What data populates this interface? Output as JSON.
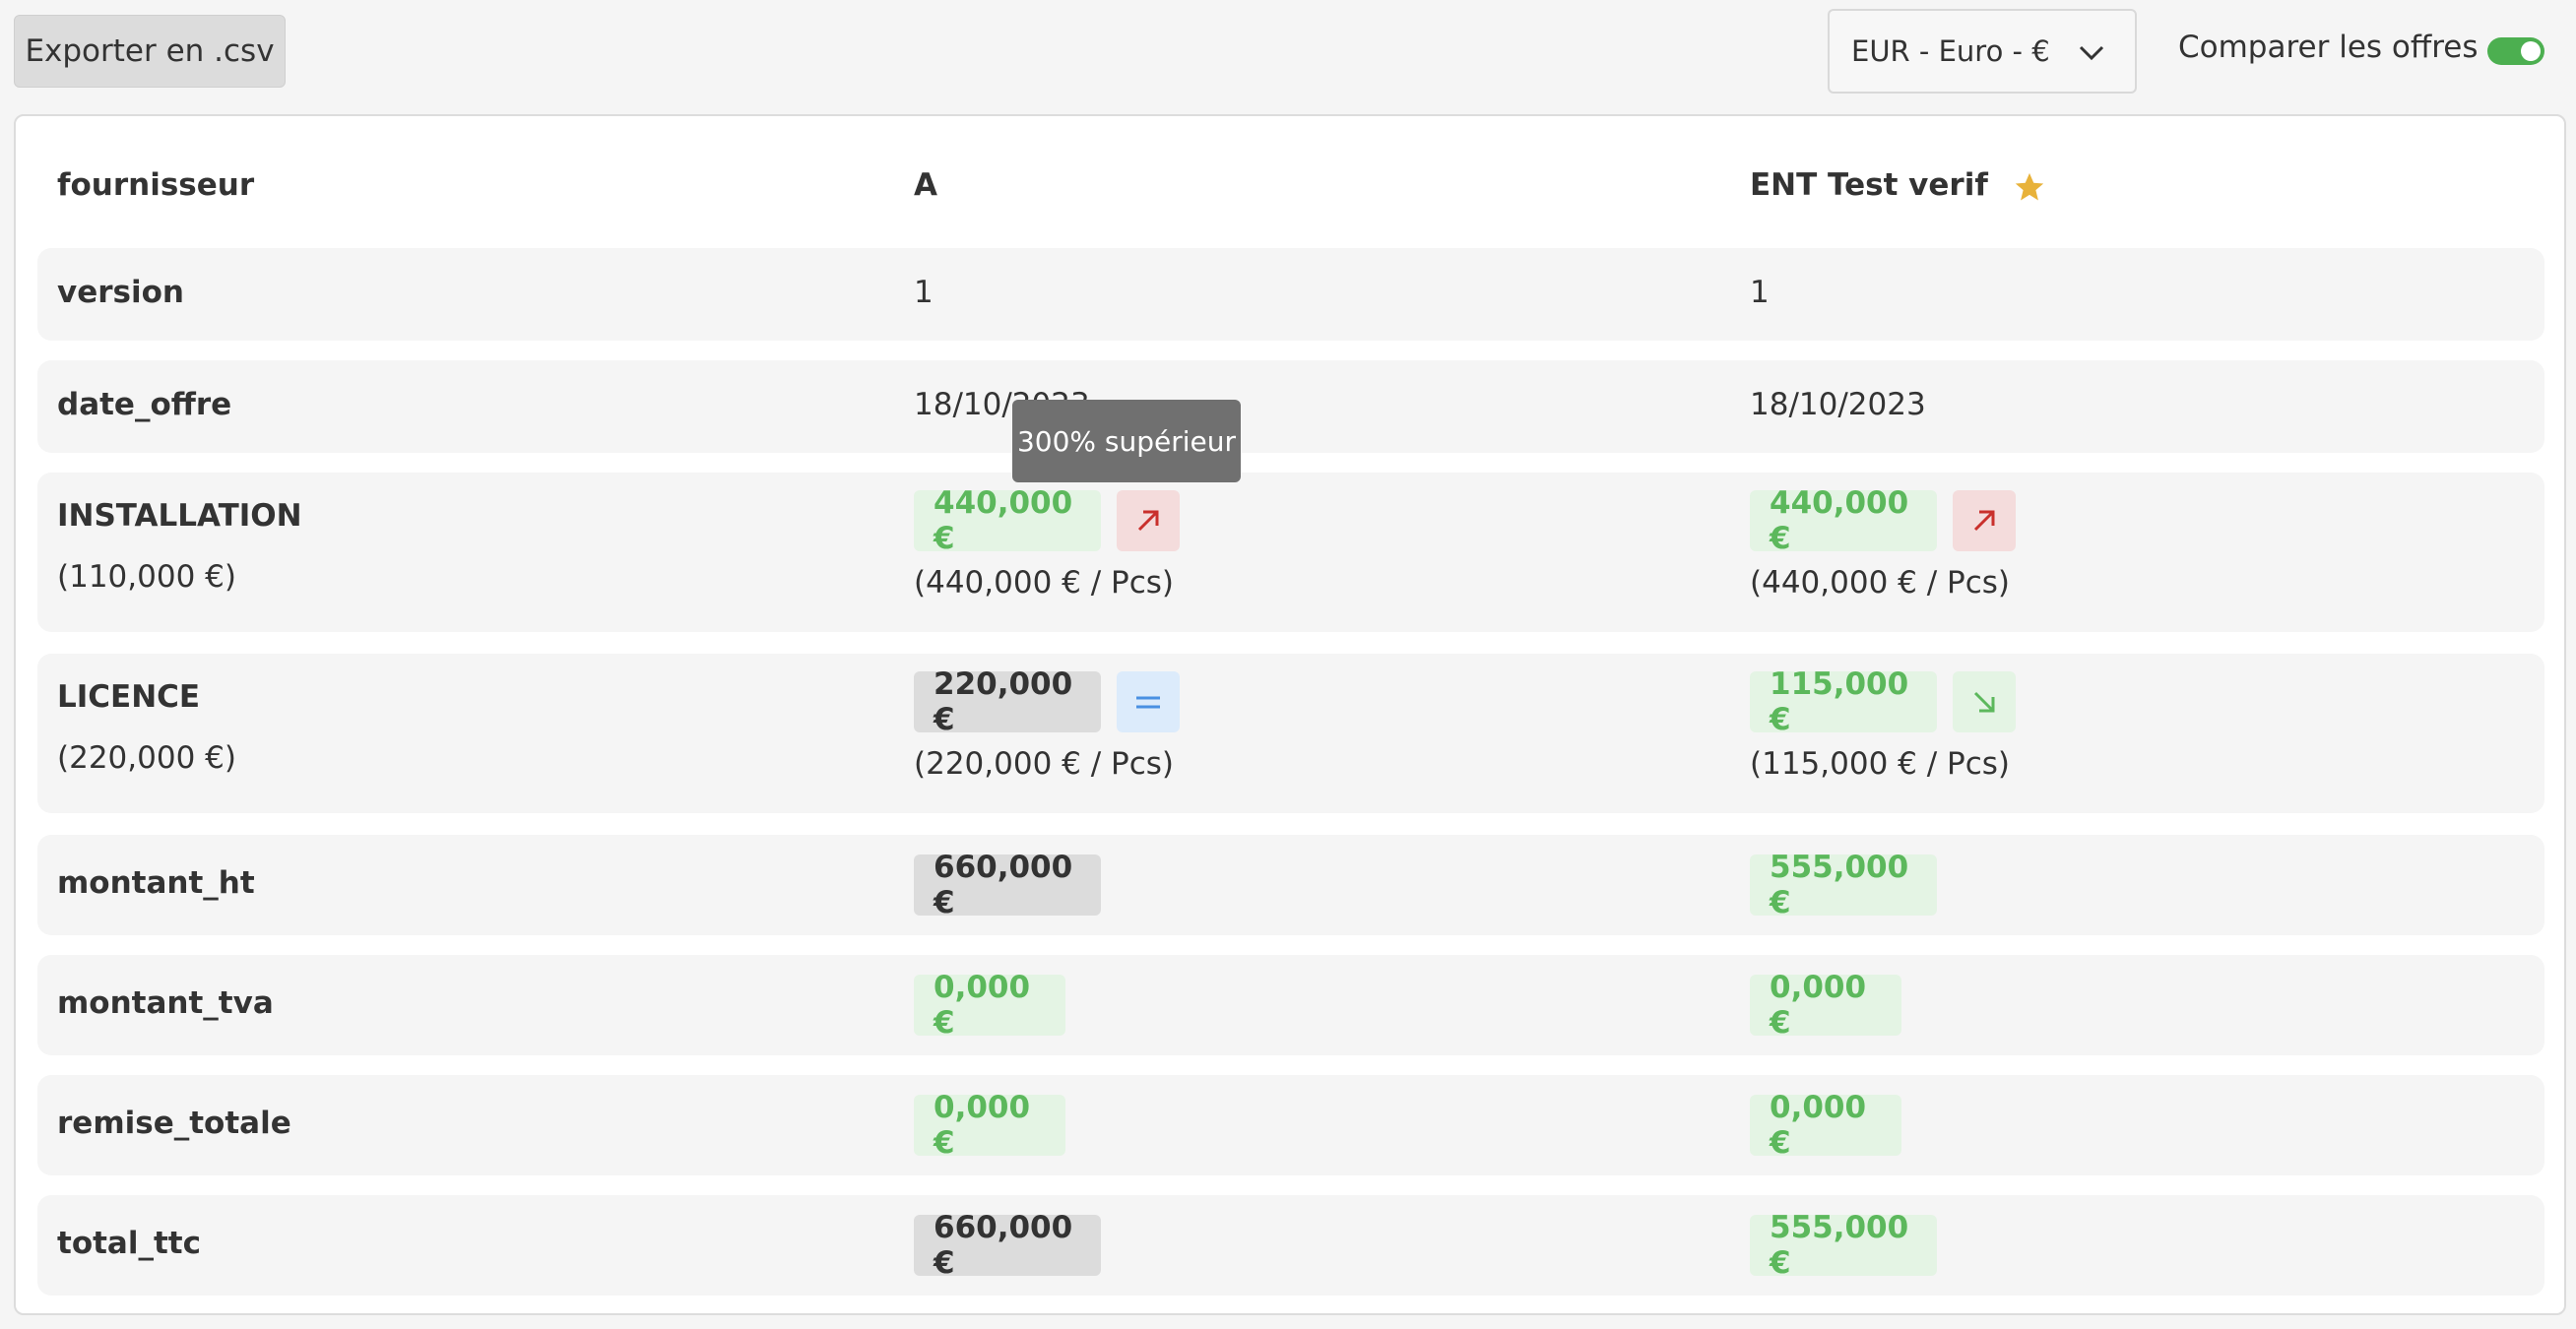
{
  "toolbar": {
    "export_label": "Exporter en .csv",
    "currency_value": "EUR - Euro - €",
    "compare_label": "Comparer les offres",
    "compare_enabled": true
  },
  "table": {
    "header": {
      "label": "fournisseur",
      "supplier_a": "A",
      "supplier_b": "ENT Test verif"
    },
    "rows": [
      {
        "label": "version",
        "a": "1",
        "b": "1"
      },
      {
        "label": "date_offre",
        "a": "18/10/2023",
        "b": "18/10/2023"
      },
      {
        "label": "INSTALLATION",
        "ref": "(110,000 €)",
        "a": "440,000 €",
        "a_unit": "(440,000 € / Pcs)",
        "a_trend": "up",
        "b": "440,000 €",
        "b_unit": "(440,000 € / Pcs)",
        "b_trend": "up"
      },
      {
        "label": "LICENCE",
        "ref": "(220,000 €)",
        "a": "220,000 €",
        "a_unit": "(220,000 € / Pcs)",
        "a_trend": "equal",
        "b": "115,000 €",
        "b_unit": "(115,000 € / Pcs)",
        "b_trend": "down"
      },
      {
        "label": "montant_ht",
        "a": "660,000 €",
        "b": "555,000 €"
      },
      {
        "label": "montant_tva",
        "a": "0,000 €",
        "b": "0,000 €"
      },
      {
        "label": "remise_totale",
        "a": "0,000 €",
        "b": "0,000 €"
      },
      {
        "label": "total_ttc",
        "a": "660,000 €",
        "b": "555,000 €"
      }
    ]
  },
  "tooltip": {
    "text": "300% supérieur"
  },
  "colors": {
    "accent_green": "#5cb85c",
    "toggle_green": "#4caf50",
    "trend_up_red": "#c9302c",
    "trend_equal_blue": "#4a90e2",
    "star_gold": "#e8b23a"
  }
}
